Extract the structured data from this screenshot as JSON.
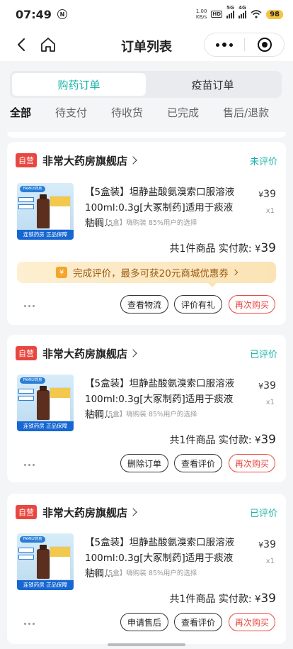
{
  "status": {
    "time": "07:49",
    "speed_value": "1.00",
    "speed_unit": "KB/s",
    "hd": "HD",
    "sig1": "5G",
    "sig2": "4G",
    "battery": "98"
  },
  "nav": {
    "title": "订单列表"
  },
  "segments": {
    "pharmacy": "购药订单",
    "vaccine": "疫苗订单"
  },
  "tabs": [
    "全部",
    "待支付",
    "待收货",
    "已完成",
    "售后/退款"
  ],
  "orders": [
    {
      "badge": "自营",
      "shop": "非常大药房旗舰店",
      "review_status": "未评价",
      "title": "【5盒装】坦静盐酸氨溴索口服溶液 100ml:0.3g[大冢制药]适用于痰液粘稠…",
      "spec": "规格：【5盒】嗨购装 85%用户的选择",
      "price_symbol": "¥",
      "price": "39",
      "qty": "x1",
      "total_label": "共1件商品  实付款:",
      "total_symbol": "¥",
      "total": "39",
      "promo": "完成评价，最多可获20元商城优惠券",
      "promo_icon": "¥",
      "buttons": [
        "查看物流",
        "评价有礼",
        "再次购买"
      ]
    },
    {
      "badge": "自营",
      "shop": "非常大药房旗舰店",
      "review_status": "已评价",
      "title": "【5盒装】坦静盐酸氨溴索口服溶液 100ml:0.3g[大冢制药]适用于痰液粘稠…",
      "spec": "规格：【5盒】嗨购装 85%用户的选择",
      "price_symbol": "¥",
      "price": "39",
      "qty": "x1",
      "total_label": "共1件商品  实付款:",
      "total_symbol": "¥",
      "total": "39",
      "buttons": [
        "删除订单",
        "查看评价",
        "再次购买"
      ]
    },
    {
      "badge": "自营",
      "shop": "非常大药房旗舰店",
      "review_status": "已评价",
      "title": "【5盒装】坦静盐酸氨溴索口服溶液 100ml:0.3g[大冢制药]适用于痰液粘稠…",
      "spec": "规格：【5盒】嗨购装 85%用户的选择",
      "price_symbol": "¥",
      "price": "39",
      "qty": "x1",
      "total_label": "共1件商品  实付款:",
      "total_symbol": "¥",
      "total": "39",
      "buttons": [
        "申请售后",
        "查看评价",
        "再次购买"
      ]
    }
  ],
  "thumb": {
    "ribbon": "连锁药房 正品保障",
    "logo": "FAMILY药房"
  },
  "colors": {
    "accent": "#19b3a8",
    "red": "#e8473f",
    "promo_text": "#9a5a12"
  }
}
